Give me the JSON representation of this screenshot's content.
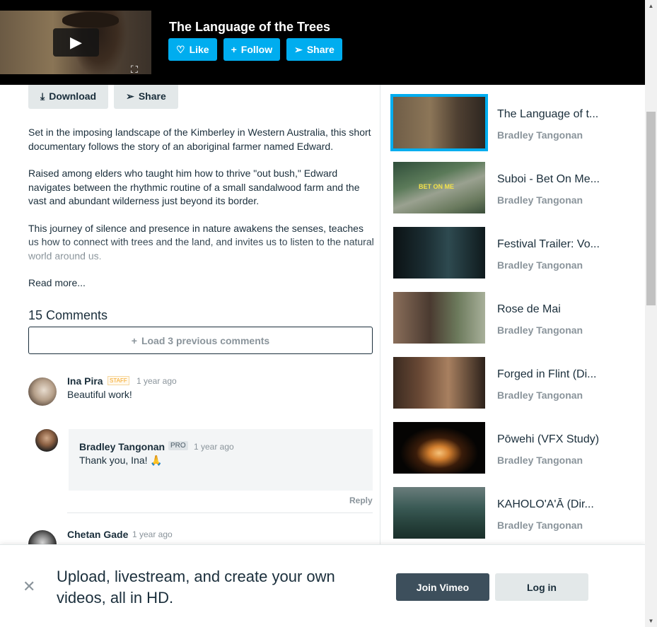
{
  "player_bar": {
    "title": "The Language of the Trees",
    "like_label": "Like",
    "follow_label": "Follow",
    "share_label": "Share"
  },
  "actions": {
    "download_label": "Download",
    "share_label": "Share"
  },
  "description": {
    "paragraphs": [
      "Set in the imposing landscape of the Kimberley in Western Australia, this short documentary follows the story of an aboriginal farmer named Edward.",
      "Raised among elders who taught him how to thrive \"out bush,\" Edward navigates between the rhythmic routine of a small sandalwood farm and the vast and abundant wilderness just beyond its border.",
      "This journey of silence and presence in nature awakens the senses, teaches us how to connect with trees and the land, and invites us to listen to the natural world around us."
    ],
    "read_more": "Read more..."
  },
  "comments": {
    "heading": "15 Comments",
    "load_previous": "Load 3 previous comments",
    "items": [
      {
        "author": "Ina Pira",
        "badge": "STAFF",
        "time": "1 year ago",
        "text": "Beautiful work!"
      },
      {
        "author": "Bradley Tangonan",
        "badge": "PRO",
        "time": "1 year ago",
        "text": "Thank you, Ina! 🙏",
        "reply_label": "Reply"
      },
      {
        "author": "Chetan Gade",
        "time": "1 year ago"
      }
    ]
  },
  "related": [
    {
      "title": "The Language of t...",
      "author": "Bradley Tangonan"
    },
    {
      "title": "Suboi - Bet On Me...",
      "author": "Bradley Tangonan",
      "thumb_caption": "BET ON ME"
    },
    {
      "title": "Festival Trailer: Vo...",
      "author": "Bradley Tangonan"
    },
    {
      "title": "Rose de Mai",
      "author": "Bradley Tangonan"
    },
    {
      "title": "Forged in Flint (Di...",
      "author": "Bradley Tangonan"
    },
    {
      "title": "Pōwehi (VFX Study)",
      "author": "Bradley Tangonan"
    },
    {
      "title": "KAHOLO'A'Ā (Dir...",
      "author": "Bradley Tangonan"
    }
  ],
  "banner": {
    "text": "Upload, livestream, and create your own videos, all in HD.",
    "join_label": "Join Vimeo",
    "login_label": "Log in"
  },
  "colors": {
    "accent": "#00adef",
    "dark_button": "#3d4f5c",
    "text": "#1a2e3b",
    "muted": "#8a949b"
  }
}
